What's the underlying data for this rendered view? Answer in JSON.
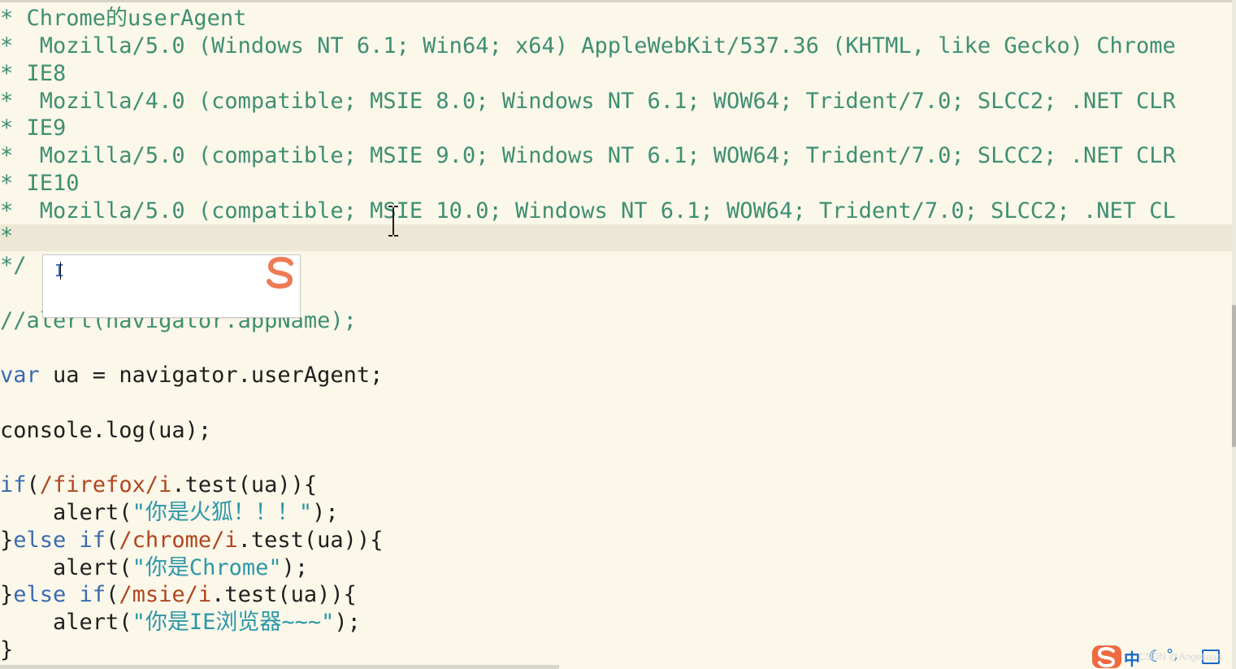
{
  "colors": {
    "background": "#fbf7e9",
    "comment": "#3f8f73",
    "keyword": "#3a6bb0",
    "regex": "#b0451f",
    "string": "#2c97a8",
    "code": "#1f1f1f"
  },
  "editor": {
    "comment_lines": [
      "* Chrome的userAgent",
      "*  Mozilla/5.0 (Windows NT 6.1; Win64; x64) AppleWebKit/537.36 (KHTML, like Gecko) Chrome",
      "* IE8",
      "*  Mozilla/4.0 (compatible; MSIE 8.0; Windows NT 6.1; WOW64; Trident/7.0; SLCC2; .NET CLR",
      "* IE9",
      "*  Mozilla/5.0 (compatible; MSIE 9.0; Windows NT 6.1; WOW64; Trident/7.0; SLCC2; .NET CLR",
      "* IE10",
      "*  Mozilla/5.0 (compatible; MSIE 10.0; Windows NT 6.1; WOW64; Trident/7.0; SLCC2; .NET CL",
      "*",
      "*/"
    ],
    "commented_alert": "//alert(navigator.appName);",
    "var_keyword": "var",
    "var_rest": " ua = navigator.userAgent;",
    "console_log": "console.log(ua);",
    "if_block": {
      "if_kw": "if",
      "if_open": "(",
      "firefox_regex": "/firefox/i",
      "test_call": ".test(ua)){",
      "alert_open": "    alert(",
      "firefox_string": "\"你是火狐！！！\"",
      "alert_close": ");",
      "else_if_kw_prefix": "}",
      "else_if_kw": "else if",
      "chrome_regex": "/chrome/i",
      "chrome_string": "\"你是Chrome\"",
      "msie_regex": "/msie/i",
      "ie_string": "\"你是IE浏览器~~~\"",
      "closing_brace": "}"
    }
  },
  "ime": {
    "input_caret": "I",
    "logo_icon": "sogou-s-logo"
  },
  "tray": {
    "language": "中",
    "moon_icon": "moon-icon",
    "punctuation_icon": "punctuation-icon",
    "keyboard_icon": "keyboard-icon"
  },
  "watermark": "CSDN @Angeliaaa"
}
